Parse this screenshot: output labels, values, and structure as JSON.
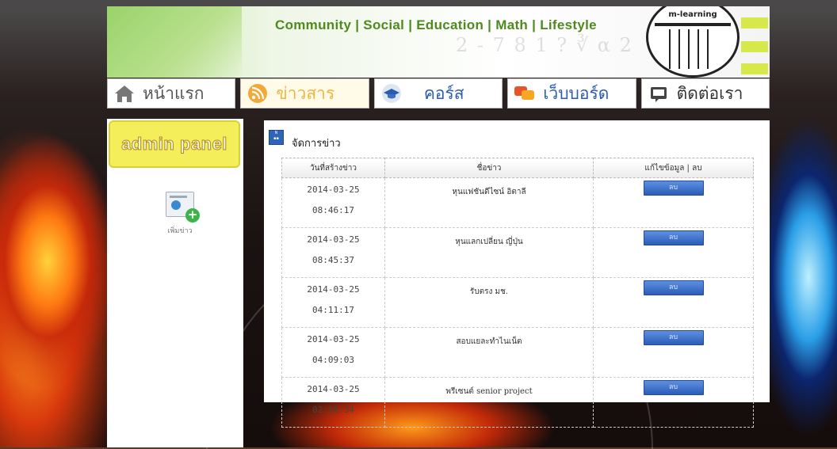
{
  "header": {
    "tagline": "Community | Social | Education | Math | Lifestyle",
    "logo_text": "m-learning",
    "decor_math": "2 - 7 8 1 ? ∛ α 2"
  },
  "nav": [
    {
      "label": "หน้าแรก",
      "icon": "home-icon"
    },
    {
      "label": "ข่าวสาร",
      "icon": "rss-icon",
      "active": true
    },
    {
      "label": "คอร์ส",
      "icon": "graduation-cap-icon"
    },
    {
      "label": "เว็บบอร์ด",
      "icon": "chat-bubbles-icon"
    },
    {
      "label": "ติดต่อเรา",
      "icon": "message-icon"
    }
  ],
  "sidebar": {
    "admin_label": "admin panel",
    "add_news_label": "เพิ่มข่าว"
  },
  "panel": {
    "title": "จัดการข่าว",
    "columns": [
      "วันที่สร้างข่าว",
      "ชื่อข่าว",
      "แก้ไขข้อมูล | ลบ"
    ],
    "rows": [
      {
        "date": "2014-03-25",
        "time": "08:46:17",
        "title": "หุนแฟชันดีไซน์ อิตาลี",
        "action": "ลบ"
      },
      {
        "date": "2014-03-25",
        "time": "08:45:37",
        "title": "หุนแลกเปลี่ยน ญี่ปุ่น",
        "action": "ลบ"
      },
      {
        "date": "2014-03-25",
        "time": "04:11:17",
        "title": "รับตรง มช.",
        "action": "ลบ"
      },
      {
        "date": "2014-03-25",
        "time": "04:09:03",
        "title": "สอบแยละทำไนเน็ต",
        "action": "ลบ"
      },
      {
        "date": "2014-03-25",
        "time": "02:10:34",
        "title": "พรีเซนต์ senior project",
        "action": "ลบ"
      }
    ]
  },
  "colors": {
    "tagline": "#4f8a1e",
    "nav_active": "#f0b640",
    "nav_link": "#2a5db0",
    "admin_panel_bg": "#f4ee5a",
    "delete_button": "#2c5cb8"
  }
}
